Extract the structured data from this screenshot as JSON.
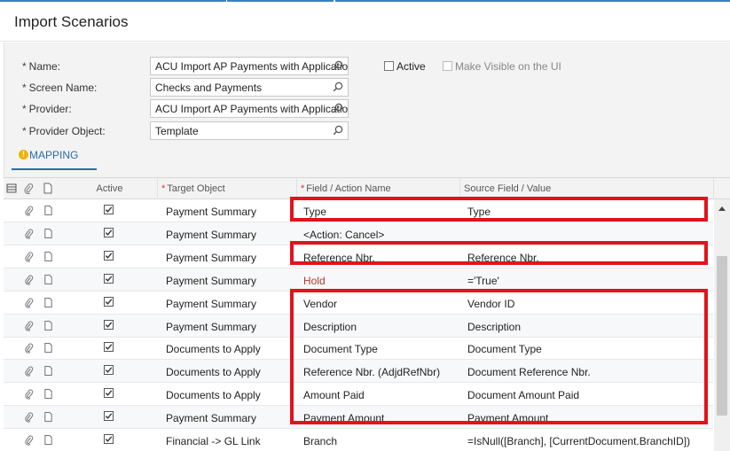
{
  "page": {
    "title": "Import Scenarios"
  },
  "form": {
    "fields": [
      {
        "label": "Name:",
        "value": "ACU Import AP Payments with Application"
      },
      {
        "label": "Screen Name:",
        "value": "Checks and Payments"
      },
      {
        "label": "Provider:",
        "value": "ACU Import AP Payments with Application"
      },
      {
        "label": "Provider Object:",
        "value": "Template"
      }
    ],
    "required_marker": "*",
    "active_label": "Active",
    "make_visible_label": "Make Visible on the UI"
  },
  "tabs": {
    "mapping_label": "MAPPING",
    "warning_glyph": "!"
  },
  "grid": {
    "headers": {
      "active": "Active",
      "target_object": "Target Object",
      "field_action": "Field / Action Name",
      "source": "Source Field / Value",
      "required_marker": "*"
    },
    "rows": [
      {
        "target": "Payment Summary",
        "field": "Type",
        "source": "Type",
        "field_style": "normal"
      },
      {
        "target": "Payment Summary",
        "field": "<Action: Cancel>",
        "source": "",
        "field_style": "normal"
      },
      {
        "target": "Payment Summary",
        "field": "Reference Nbr.",
        "source": "Reference Nbr.",
        "field_style": "normal"
      },
      {
        "target": "Payment Summary",
        "field": "Hold",
        "source": "='True'",
        "field_style": "red"
      },
      {
        "target": "Payment Summary",
        "field": "Vendor",
        "source": "Vendor ID",
        "field_style": "normal"
      },
      {
        "target": "Payment Summary",
        "field": "Description",
        "source": "Description",
        "field_style": "normal"
      },
      {
        "target": "Documents to Apply",
        "field": "Document Type",
        "source": "Document Type",
        "field_style": "normal"
      },
      {
        "target": "Documents to Apply",
        "field": "Reference Nbr. (AdjdRefNbr)",
        "source": "Document Reference Nbr.",
        "field_style": "normal"
      },
      {
        "target": "Documents to Apply",
        "field": "Amount Paid",
        "source": "Document Amount Paid",
        "field_style": "normal"
      },
      {
        "target": "Payment Summary",
        "field": "Payment Amount",
        "source": "Payment Amount",
        "field_style": "normal"
      },
      {
        "target": "Financial -> GL Link",
        "field": "Branch",
        "source": "=IsNull([Branch], [CurrentDocument.BranchID])",
        "field_style": "normal"
      }
    ]
  },
  "colors": {
    "accent": "#2b6cb0",
    "highlight": "#e2131d",
    "warning": "#f0b400",
    "required": "#d33333"
  },
  "icons": [
    "search-icon",
    "warning-icon",
    "paperclip-icon",
    "document-icon",
    "checkbox-checked-icon",
    "grid-menu-icon",
    "scroll-up-icon"
  ]
}
